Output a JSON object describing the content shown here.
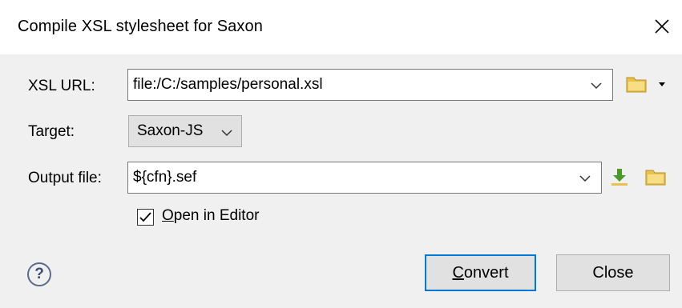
{
  "dialog": {
    "title": "Compile XSL stylesheet for Saxon"
  },
  "xsl_url": {
    "label": "XSL URL:",
    "value": "file:/C:/samples/personal.xsl"
  },
  "target": {
    "label": "Target:",
    "value": "Saxon-JS"
  },
  "output_file": {
    "label": "Output file:",
    "value": "${cfn}.sef"
  },
  "open_in_editor": {
    "mnemonic": "O",
    "rest": "pen in Editor",
    "checked": true
  },
  "buttons": {
    "convert_mnemonic": "C",
    "convert_rest": "onvert",
    "close": "Close"
  },
  "help_symbol": "?",
  "colors": {
    "folder": "#e8c14a",
    "download": "#4a9a2a",
    "accent": "#0078d7"
  }
}
